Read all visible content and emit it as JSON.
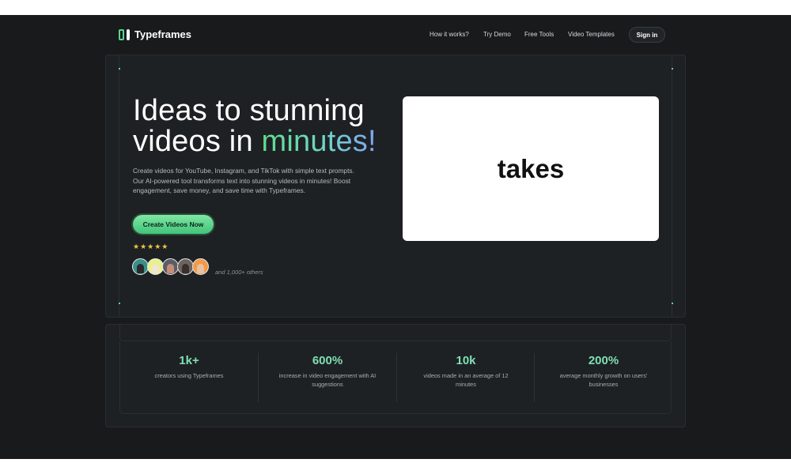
{
  "brand": {
    "name": "Typeframes",
    "logo_icon": "typeframes-logo-icon"
  },
  "nav": {
    "links": [
      "How it works?",
      "Try Demo",
      "Free Tools",
      "Video Templates"
    ],
    "sign_in": "Sign in"
  },
  "hero": {
    "headline_line1": "Ideas to stunning",
    "headline_line2_plain": "videos in ",
    "headline_line2_accent": "minutes!",
    "description": "Create videos for YouTube, Instagram, and TikTok with simple text prompts. Our AI-powered tool transforms text into stunning videos in minutes! Boost engagement, save money, and save time with Typeframes.",
    "cta_label": "Create Videos Now",
    "rating_stars": "★★★★★",
    "rating_value": 5,
    "social_proof": "and 1,000+ others",
    "preview_word": "takes"
  },
  "stats": [
    {
      "value": "1k+",
      "label": "creators using Typeframes"
    },
    {
      "value": "600%",
      "label": "increase in video engagement with AI suggestions"
    },
    {
      "value": "10k",
      "label": "videos made in an average of 12 minutes"
    },
    {
      "value": "200%",
      "label": "average monthly growth on users' businesses"
    }
  ],
  "colors": {
    "background": "#181a1c",
    "accent_green": "#56d98a",
    "accent_blue": "#7ea3f5",
    "star": "#f5c542"
  }
}
